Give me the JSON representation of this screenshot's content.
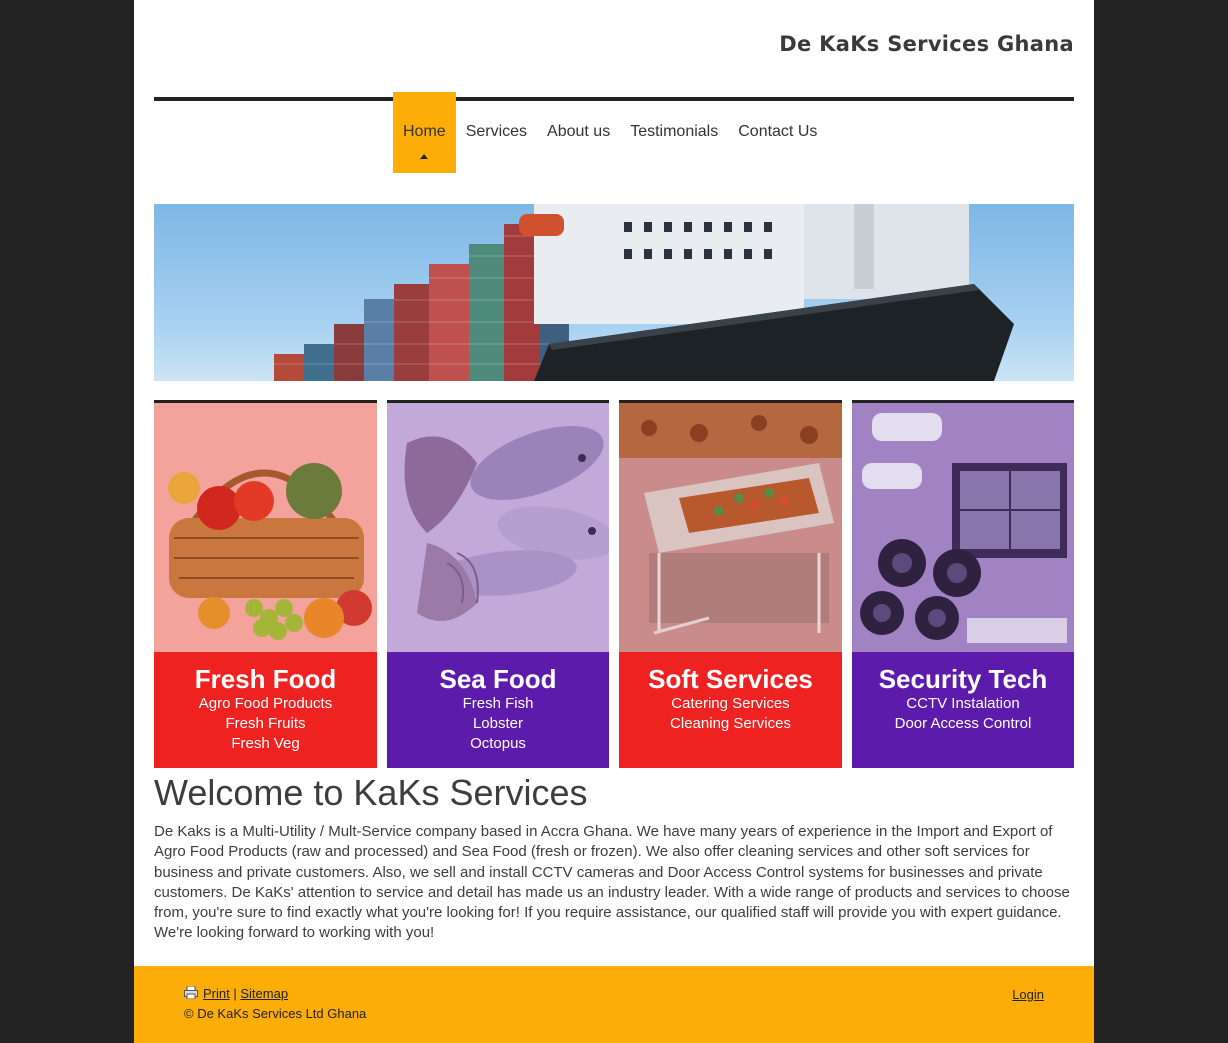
{
  "header": {
    "site_title": "De KaKs Services Ghana"
  },
  "nav": {
    "items": [
      {
        "label": "Home",
        "active": true
      },
      {
        "label": "Services"
      },
      {
        "label": "About us"
      },
      {
        "label": "Testimonials"
      },
      {
        "label": "Contact Us"
      }
    ]
  },
  "tiles": [
    {
      "title": "Fresh Food",
      "lines": [
        "Agro Food Products",
        "Fresh Fruits",
        "Fresh Veg"
      ],
      "color": "#ee2220",
      "image": "fruit-vegetable-basket"
    },
    {
      "title": "Sea Food",
      "lines": [
        "Fresh Fish",
        "Lobster",
        "Octopus"
      ],
      "color": "#5d1bab",
      "image": "seafood-fish-lobster"
    },
    {
      "title": "Soft Services",
      "lines": [
        "Catering Services",
        "Cleaning Services"
      ],
      "color": "#ee2220",
      "image": "catering-chafing-dish"
    },
    {
      "title": "Security Tech",
      "lines": [
        "CCTV Instalation",
        "Door Access Control"
      ],
      "color": "#5d1bab",
      "image": "cctv-cameras-monitor"
    }
  ],
  "welcome": {
    "heading": "Welcome to KaKs Services",
    "body": "De Kaks is a Multi-Utility / Mult-Service company based in Accra Ghana. We have many years of experience in the Import and Export of Agro Food Products (raw and processed) and Sea Food (fresh or frozen). We also offer cleaning services and other soft services for business and private customers. Also, we sell and install CCTV cameras and Door Access Control systems for businesses and private customers. De KaKs' attention to service and detail has made us an industry leader. With a wide range of products and services to choose from, you're sure to find exactly what you're looking for! If you require assistance, our qualified staff will provide you with expert guidance. We're looking forward to working with you!"
  },
  "footer": {
    "print_label": "Print",
    "separator": "|",
    "sitemap_label": "Sitemap",
    "copyright": "© De KaKs Services Ltd Ghana",
    "login_label": "Login"
  },
  "colors": {
    "accent": "#fdad08",
    "red": "#ee2220",
    "purple": "#5d1bab",
    "page_bg": "#232323"
  }
}
